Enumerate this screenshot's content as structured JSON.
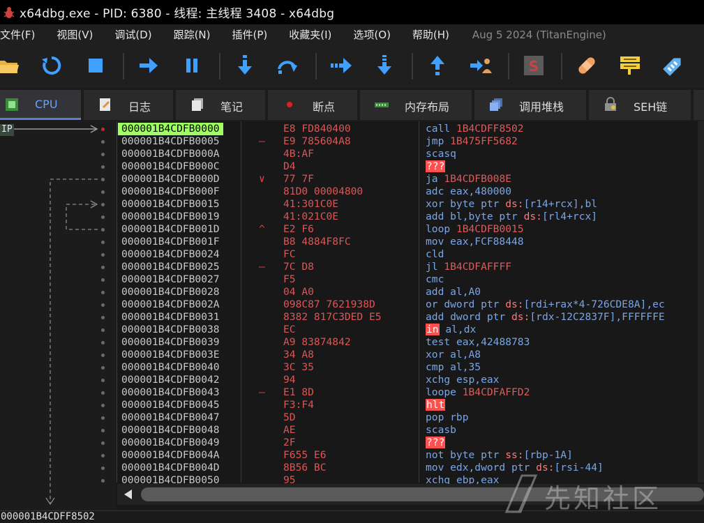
{
  "window": {
    "title": "x64dbg.exe - PID: 6380 - 线程: 主线程 3408 - x64dbg"
  },
  "menu": {
    "items": [
      "文件(F)",
      "视图(V)",
      "调试(D)",
      "跟踪(N)",
      "插件(P)",
      "收藏夹(I)",
      "选项(O)",
      "帮助(H)"
    ],
    "build_info": "Aug 5 2024 (TitanEngine)"
  },
  "toolbar": {
    "buttons": [
      "open-icon",
      "restart-icon",
      "stop-icon",
      "run-icon",
      "pause-icon",
      "step-into-icon",
      "step-over-icon",
      "trace-into-icon",
      "trace-over-icon",
      "execute-till-return-icon",
      "run-to-user-code-icon",
      "script-icon",
      "patch-icon",
      "comments-icon",
      "labels-icon"
    ]
  },
  "tabs": [
    {
      "label": "CPU",
      "icon": "cpu-icon",
      "active": true
    },
    {
      "label": "日志",
      "icon": "log-icon",
      "active": false
    },
    {
      "label": "笔记",
      "icon": "notes-icon",
      "active": false
    },
    {
      "label": "断点",
      "icon": "breakpoint-icon",
      "active": false
    },
    {
      "label": "内存布局",
      "icon": "memory-map-icon",
      "active": false
    },
    {
      "label": "调用堆栈",
      "icon": "call-stack-icon",
      "active": false
    },
    {
      "label": "SEH链",
      "icon": "seh-chain-icon",
      "active": false
    }
  ],
  "disassembly": {
    "ip_label": "IP",
    "rows": [
      {
        "addr": "000001B4CDFB0000",
        "mark": "",
        "bytes": "E8 FD840400",
        "instr": "call 1B4CDFF8502"
      },
      {
        "addr": "000001B4CDFB0005",
        "mark": "—",
        "bytes": "E9 785604A8",
        "instr": "jmp 1B475FF5682"
      },
      {
        "addr": "000001B4CDFB000A",
        "mark": "",
        "bytes": "4B:AF",
        "instr": "scasq"
      },
      {
        "addr": "000001B4CDFB000C",
        "mark": "",
        "bytes": "D4",
        "instr": "???"
      },
      {
        "addr": "000001B4CDFB000D",
        "mark": "∨",
        "bytes": "77 7F",
        "instr": "ja 1B4CDFB008E"
      },
      {
        "addr": "000001B4CDFB000F",
        "mark": "",
        "bytes": "81D0 00004800",
        "instr": "adc eax,480000"
      },
      {
        "addr": "000001B4CDFB0015",
        "mark": "",
        "bytes": "41:301C0E",
        "instr": "xor byte ptr ds:[r14+rcx],bl"
      },
      {
        "addr": "000001B4CDFB0019",
        "mark": "",
        "bytes": "41:021C0E",
        "instr": "add bl,byte ptr ds:[rl4+rcx]"
      },
      {
        "addr": "000001B4CDFB001D",
        "mark": "^",
        "bytes": "E2 F6",
        "instr": "loop 1B4CDFB0015"
      },
      {
        "addr": "000001B4CDFB001F",
        "mark": "",
        "bytes": "B8 4884F8FC",
        "instr": "mov eax,FCF88448"
      },
      {
        "addr": "000001B4CDFB0024",
        "mark": "",
        "bytes": "FC",
        "instr": "cld"
      },
      {
        "addr": "000001B4CDFB0025",
        "mark": "—",
        "bytes": "7C D8",
        "instr": "jl 1B4CDFAFFFF"
      },
      {
        "addr": "000001B4CDFB0027",
        "mark": "",
        "bytes": "F5",
        "instr": "cmc"
      },
      {
        "addr": "000001B4CDFB0028",
        "mark": "",
        "bytes": "04 A0",
        "instr": "add al,A0"
      },
      {
        "addr": "000001B4CDFB002A",
        "mark": "",
        "bytes": "098C87 7621938D",
        "instr": "or dword ptr ds:[rdi+rax*4-726CDE8A],ec"
      },
      {
        "addr": "000001B4CDFB0031",
        "mark": "",
        "bytes": "8382 817C3DED E5",
        "instr": "add dword ptr ds:[rdx-12C2837F],FFFFFFE"
      },
      {
        "addr": "000001B4CDFB0038",
        "mark": "",
        "bytes": "EC",
        "instr": "in al,dx"
      },
      {
        "addr": "000001B4CDFB0039",
        "mark": "",
        "bytes": "A9 83874842",
        "instr": "test eax,42488783"
      },
      {
        "addr": "000001B4CDFB003E",
        "mark": "",
        "bytes": "34 A8",
        "instr": "xor al,A8"
      },
      {
        "addr": "000001B4CDFB0040",
        "mark": "",
        "bytes": "3C 35",
        "instr": "cmp al,35"
      },
      {
        "addr": "000001B4CDFB0042",
        "mark": "",
        "bytes": "94",
        "instr": "xchg esp,eax"
      },
      {
        "addr": "000001B4CDFB0043",
        "mark": "—",
        "bytes": "E1 8D",
        "instr": "loope 1B4CDFAFFD2"
      },
      {
        "addr": "000001B4CDFB0045",
        "mark": "",
        "bytes": "F3:F4",
        "instr": "hlt"
      },
      {
        "addr": "000001B4CDFB0047",
        "mark": "",
        "bytes": "5D",
        "instr": "pop rbp"
      },
      {
        "addr": "000001B4CDFB0048",
        "mark": "",
        "bytes": "AE",
        "instr": "scasb"
      },
      {
        "addr": "000001B4CDFB0049",
        "mark": "",
        "bytes": "2F",
        "instr": "???"
      },
      {
        "addr": "000001B4CDFB004A",
        "mark": "",
        "bytes": "F655 E6",
        "instr": "not byte ptr ss:[rbp-1A]"
      },
      {
        "addr": "000001B4CDFB004D",
        "mark": "",
        "bytes": "8B56 BC",
        "instr": "mov edx,dword ptr ds:[rsi-44]"
      },
      {
        "addr": "000001B4CDFB0050",
        "mark": "",
        "bytes": "95",
        "instr": "xchg ebp,eax"
      }
    ]
  },
  "status": {
    "text": "000001B4CDFF8502"
  },
  "watermark": {
    "text": "先知社区"
  },
  "colors": {
    "accent": "#5a7fd0",
    "current_row": "#9dff62",
    "bytes": "#e05555",
    "instruction": "#7aa6e6",
    "bad_instruction": "#ff5050"
  }
}
